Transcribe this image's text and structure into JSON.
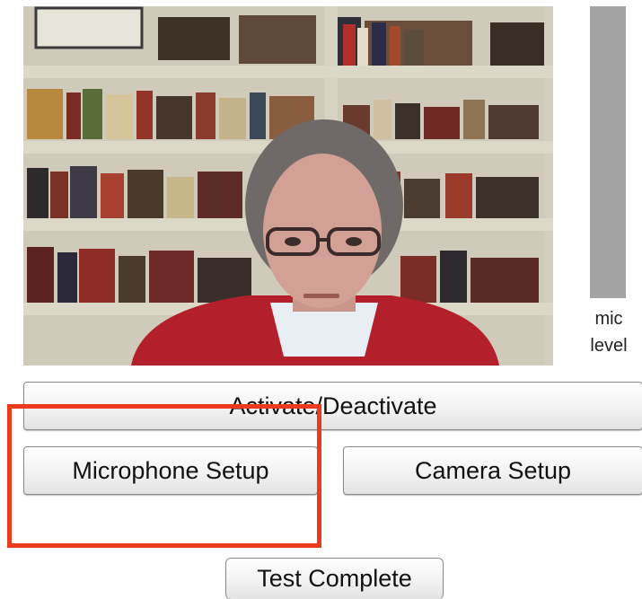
{
  "meter": {
    "label": "mic\nlevel"
  },
  "buttons": {
    "activate": "Activate/Deactivate",
    "microphone": "Microphone Setup",
    "camera": "Camera Setup",
    "complete": "Test Complete"
  },
  "colors": {
    "meter_fill": "#a3a3a3",
    "highlight": "#ee3a1c"
  }
}
